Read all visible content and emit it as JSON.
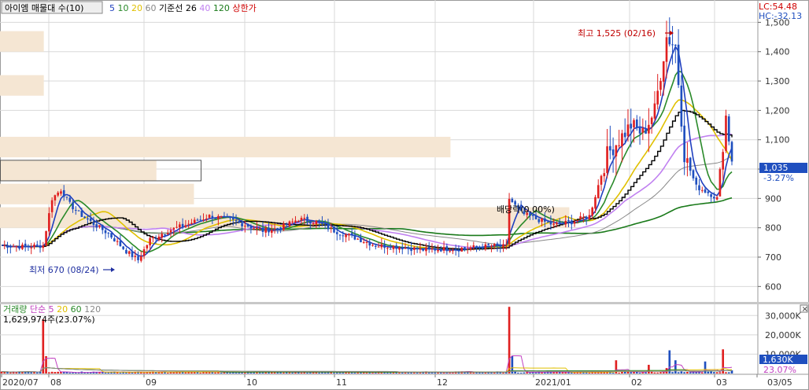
{
  "header": {
    "title": "아이엠 매물대 수(10)",
    "ma_periods": [
      {
        "label": "5",
        "color": "#1f3fbf"
      },
      {
        "label": "10",
        "color": "#2a8a2a"
      },
      {
        "label": "20",
        "color": "#e0c000"
      },
      {
        "label": "60",
        "color": "#888888"
      },
      {
        "label": "기준선 26",
        "color": "#000000"
      },
      {
        "label": "40",
        "color": "#c080f0"
      },
      {
        "label": "120",
        "color": "#1a7a1a"
      },
      {
        "label": "상한가",
        "color": "#d00000"
      }
    ]
  },
  "top_right": {
    "lc": "LC:54.48",
    "hc": "HC:-32.13"
  },
  "annotations": {
    "high": "최고 1,525 (02/16)",
    "low": "최저 670 (08/24)",
    "dividend": "배당락(0.00%)"
  },
  "price_axis": {
    "ticks": [
      "1,500",
      "1,400",
      "1,300",
      "1,200",
      "1,100",
      "1,000",
      "900",
      "800",
      "700",
      "600"
    ],
    "current": "1,035",
    "change": "-3.27%"
  },
  "volume_header": {
    "label": "거래량",
    "ma_label": "단순",
    "periods": [
      {
        "label": "5",
        "color": "#c040c0"
      },
      {
        "label": "20",
        "color": "#e0c000"
      },
      {
        "label": "60",
        "color": "#2a8a2a"
      },
      {
        "label": "120",
        "color": "#888888"
      }
    ],
    "value": "1,629,974주(23.07%)"
  },
  "volume_axis": {
    "ticks": [
      "30,000K",
      "20,000K",
      "10,000K"
    ],
    "current": "1,630K",
    "ratio": "23.07%"
  },
  "x_axis": {
    "labels": [
      "2020/07",
      "08",
      "09",
      "10",
      "11",
      "12",
      "2021/01",
      "02",
      "03",
      "03/05"
    ]
  },
  "colors": {
    "up": "#e02020",
    "down": "#1f4fbf",
    "volume_profile": "#f5e6d3",
    "grid": "#d8d8d8"
  },
  "chart_data": {
    "type": "candlestick",
    "title": "아이엠 매물대 수(10)",
    "x_range": [
      "2020/07",
      "2021/03/05"
    ],
    "ylim": [
      550,
      1560
    ],
    "y_ticks": [
      600,
      700,
      800,
      900,
      1000,
      1100,
      1200,
      1300,
      1400,
      1500
    ],
    "high": {
      "value": 1525,
      "date": "02/16"
    },
    "low": {
      "value": 670,
      "date": "08/24"
    },
    "last_close": 1035,
    "change_pct": -3.27,
    "close_series_approx": [
      {
        "x": "2020/07",
        "y": 730
      },
      {
        "x": "08",
        "y": 760
      },
      {
        "x": "08",
        "y": 940
      },
      {
        "x": "08",
        "y": 850
      },
      {
        "x": "08",
        "y": 700
      },
      {
        "x": "09",
        "y": 820
      },
      {
        "x": "09",
        "y": 860
      },
      {
        "x": "09",
        "y": 800
      },
      {
        "x": "10",
        "y": 830
      },
      {
        "x": "10",
        "y": 760
      },
      {
        "x": "11",
        "y": 735
      },
      {
        "x": "11",
        "y": 728
      },
      {
        "x": "12",
        "y": 730
      },
      {
        "x": "12",
        "y": 740
      },
      {
        "x": "12",
        "y": 900
      },
      {
        "x": "2021/01",
        "y": 820
      },
      {
        "x": "2021/01",
        "y": 1050
      },
      {
        "x": "02",
        "y": 1200
      },
      {
        "x": "02",
        "y": 1450
      },
      {
        "x": "02",
        "y": 1000
      },
      {
        "x": "03",
        "y": 900
      },
      {
        "x": "03",
        "y": 1180
      },
      {
        "x": "03/05",
        "y": 1035
      }
    ],
    "volume_profile_rows": [
      {
        "price_from": 1400,
        "price_to": 1470,
        "relative": 0.07
      },
      {
        "price_from": 1250,
        "price_to": 1320,
        "relative": 0.07
      },
      {
        "price_from": 1040,
        "price_to": 1110,
        "relative": 0.72
      },
      {
        "price_from": 960,
        "price_to": 1030,
        "relative": 0.25
      },
      {
        "price_from": 880,
        "price_to": 950,
        "relative": 0.31
      },
      {
        "price_from": 800,
        "price_to": 870,
        "relative": 0.91
      }
    ],
    "volume": {
      "ylim": [
        0,
        35000
      ],
      "unit": "K",
      "last": 1630,
      "peaks_approx": [
        {
          "x": "2020/07",
          "y": 28000
        },
        {
          "x": "12",
          "y": 35000
        },
        {
          "x": "02",
          "y": 30000
        },
        {
          "x": "03",
          "y": 13000
        }
      ]
    }
  }
}
